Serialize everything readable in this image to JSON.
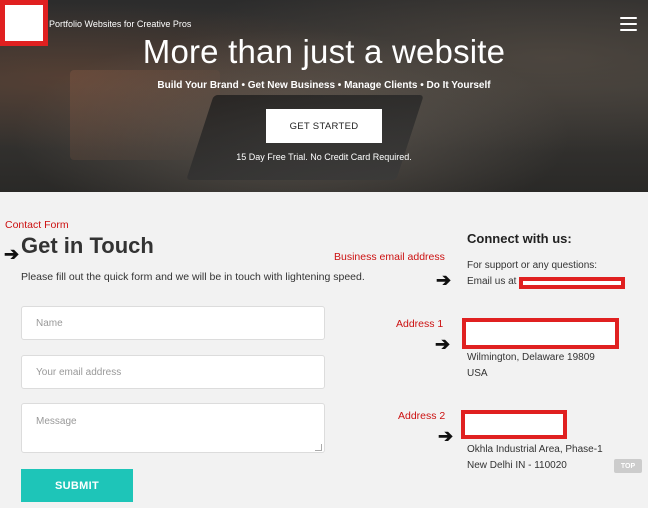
{
  "header": {
    "tagline": "Portfolio Websites for Creative Pros",
    "menu_icon": "hamburger-menu-icon"
  },
  "hero": {
    "title": "More than just a website",
    "subtitle": "Build Your Brand  •  Get New Business  •  Manage Clients  •  Do It Yourself",
    "cta_label": "GET STARTED",
    "trial_note": "15 Day Free Trial. No Credit Card Required."
  },
  "annotations": {
    "contact_form": "Contact Form",
    "business_email": "Business email address",
    "address_1": "Address 1",
    "address_2": "Address 2",
    "arrow_glyph": "➔"
  },
  "contact": {
    "title": "Get in Touch",
    "description": "Please fill out the quick form and we will be in touch with lightening speed.",
    "name_placeholder": "Name",
    "email_placeholder": "Your email address",
    "message_placeholder": "Message",
    "submit_label": "SUBMIT"
  },
  "connect": {
    "title": "Connect with us:",
    "support_text": "For support or any questions:",
    "email_label": "Email us at",
    "address1_line1": "Wilmington, Delaware 19809",
    "address1_line2": "USA",
    "address2_line1": "Okhla Industrial Area, Phase-1",
    "address2_line2": "New Delhi IN - 110020"
  },
  "scroll_top_label": "TOP",
  "colors": {
    "accent": "#1ec5b8",
    "annotation": "#cc1111",
    "redaction": "#e02020"
  }
}
